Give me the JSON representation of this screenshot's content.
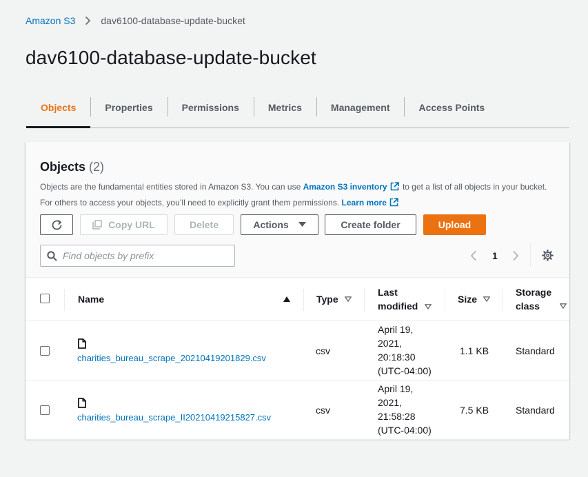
{
  "breadcrumb": {
    "root": "Amazon S3",
    "current": "dav6100-database-update-bucket"
  },
  "page_title": "dav6100-database-update-bucket",
  "tabs": [
    "Objects",
    "Properties",
    "Permissions",
    "Metrics",
    "Management",
    "Access Points"
  ],
  "active_tab": "Objects",
  "panel": {
    "title": "Objects",
    "count": "(2)",
    "description": {
      "part1": "Objects are the fundamental entities stored in Amazon S3. You can use ",
      "inventory_link": "Amazon S3 inventory",
      "part2": " to get a list of all objects in your bucket. For others to access your objects, you’ll need to explicitly grant them permissions. ",
      "learn_more": "Learn more"
    }
  },
  "toolbar": {
    "copy_url": "Copy URL",
    "delete": "Delete",
    "actions": "Actions",
    "create_folder": "Create folder",
    "upload": "Upload"
  },
  "search": {
    "placeholder": "Find objects by prefix",
    "value": ""
  },
  "pagination": {
    "current_page": "1"
  },
  "table": {
    "columns": {
      "name": "Name",
      "type": "Type",
      "last_modified": [
        "Last",
        "modified"
      ],
      "size": "Size",
      "storage_class": [
        "Storage",
        "class"
      ]
    },
    "sort": {
      "column": "Name",
      "direction": "ascending"
    },
    "rows": [
      {
        "name": "charities_bureau_scrape_20210419201829.csv",
        "type": "csv",
        "last_modified": [
          "April 19,",
          "2021,",
          "20:18:30",
          "(UTC-04:00)"
        ],
        "size": "1.1 KB",
        "storage_class": "Standard"
      },
      {
        "name": "charities_bureau_scrape_II20210419215827.csv",
        "type": "csv",
        "last_modified": [
          "April 19,",
          "2021,",
          "21:58:28",
          "(UTC-04:00)"
        ],
        "size": "7.5 KB",
        "storage_class": "Standard"
      }
    ]
  },
  "colors": {
    "link": "#0073bb",
    "accent": "#ec7211",
    "text": "#16191f",
    "muted": "#545b64",
    "background": "#f2f3f3"
  },
  "icons": [
    "chevron-right-icon",
    "external-link-icon",
    "refresh-icon",
    "copy-icon",
    "caret-down-icon",
    "search-icon",
    "chevron-left-icon",
    "gear-icon",
    "sort-ascending-icon",
    "sort-descending-icon",
    "file-icon"
  ]
}
